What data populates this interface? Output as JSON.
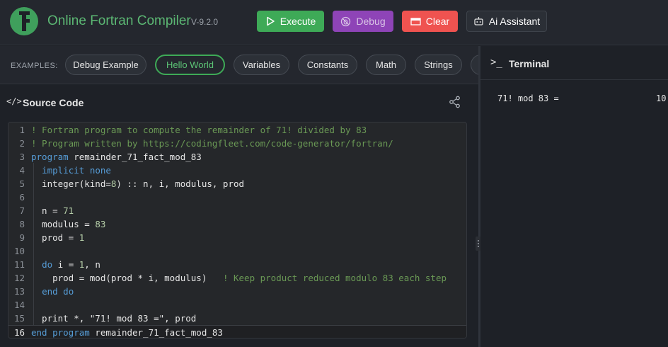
{
  "header": {
    "title": "Online Fortran Compiler",
    "version": "V-9.2.0",
    "logo_icon": "fortran-logo-icon",
    "buttons": {
      "execute": "Execute",
      "debug": "Debug",
      "clear": "Clear",
      "ai_assistant": "Ai Assistant"
    }
  },
  "examples": {
    "label": "EXAMPLES:",
    "chips": [
      "Debug Example",
      "Hello World",
      "Variables",
      "Constants",
      "Math",
      "Strings"
    ],
    "active": "Hello World"
  },
  "source": {
    "title": "Source Code",
    "code_icon": "</>",
    "lines": [
      {
        "n": "1",
        "t": "! Fortran program to compute the remainder of 71! divided by 83"
      },
      {
        "n": "2",
        "t": "! Program written by https://codingfleet.com/code-generator/fortran/"
      },
      {
        "n": "3",
        "t": "program remainder_71_fact_mod_83"
      },
      {
        "n": "4",
        "t": "  implicit none"
      },
      {
        "n": "5",
        "t": "  integer(kind=8) :: n, i, modulus, prod"
      },
      {
        "n": "6",
        "t": ""
      },
      {
        "n": "7",
        "t": "  n = 71"
      },
      {
        "n": "8",
        "t": "  modulus = 83"
      },
      {
        "n": "9",
        "t": "  prod = 1"
      },
      {
        "n": "10",
        "t": ""
      },
      {
        "n": "11",
        "t": "  do i = 1, n"
      },
      {
        "n": "12",
        "t": "    prod = mod(prod * i, modulus)   ! Keep product reduced modulo 83 each step"
      },
      {
        "n": "13",
        "t": "  end do"
      },
      {
        "n": "14",
        "t": ""
      },
      {
        "n": "15",
        "t": "  print *, \"71! mod 83 =\", prod"
      },
      {
        "n": "16",
        "t": "end program remainder_71_fact_mod_83"
      }
    ]
  },
  "terminal": {
    "title": "Terminal",
    "prompt_icon": ">_",
    "output": "71! mod 83 =                   10"
  },
  "colors": {
    "accent_green": "#3eaa57",
    "debug_purple": "#8e44b7",
    "clear_red": "#ef5350",
    "comment_green": "#6a9955",
    "keyword_blue": "#569cd6",
    "number_green": "#b5cea8"
  }
}
